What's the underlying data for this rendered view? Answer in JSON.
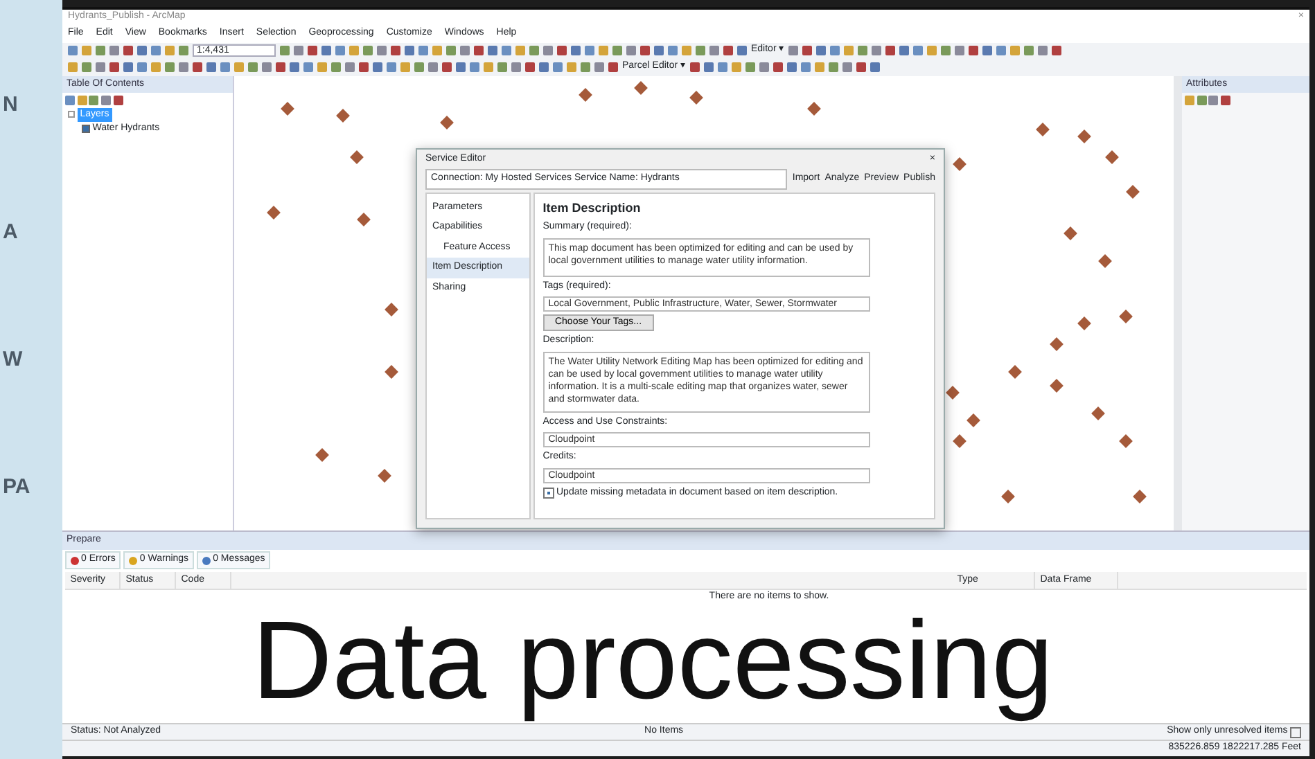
{
  "map_labels": [
    "N",
    "A",
    "W",
    "PA"
  ],
  "window": {
    "title": "Hydrants_Publish - ArcMap",
    "close": "×"
  },
  "menu": [
    "File",
    "Edit",
    "View",
    "Bookmarks",
    "Insert",
    "Selection",
    "Geoprocessing",
    "Customize",
    "Windows",
    "Help"
  ],
  "toolbar": {
    "scale": "1:4,431",
    "editor": "Editor ▾",
    "parcel_editor": "Parcel Editor ▾"
  },
  "toc": {
    "title": "Table Of Contents",
    "tree": [
      {
        "label": "Layers",
        "selected": true,
        "expanded": true,
        "children": [
          {
            "label": "Water Hydrants",
            "checked": true
          }
        ]
      }
    ]
  },
  "attributes": {
    "title": "Attributes"
  },
  "dialog": {
    "title": "Service Editor",
    "close": "×",
    "connection": "Connection: My Hosted Services   Service Name: Hydrants",
    "actions": [
      "Import",
      "Analyze",
      "Preview",
      "Publish"
    ],
    "nav": [
      {
        "label": "Parameters",
        "selected": false
      },
      {
        "label": "Capabilities",
        "selected": false,
        "children": [
          {
            "label": "Feature Access",
            "selected": false
          }
        ]
      },
      {
        "label": "Item Description",
        "selected": true
      },
      {
        "label": "Sharing",
        "selected": false
      }
    ],
    "heading": "Item Description",
    "fields": [
      {
        "kind": "textarea",
        "label": "Summary (required):",
        "value": "This map document has been optimized for editing and can be used by local government utilities to manage water utility information."
      },
      {
        "kind": "input",
        "label": "Tags (required):",
        "value": "Local Government, Public Infrastructure, Water, Sewer, Stormwater"
      },
      {
        "kind": "button",
        "label": "Choose Your Tags..."
      },
      {
        "kind": "textarea",
        "label": "Description:",
        "value": "The Water Utility Network Editing Map has been optimized for editing and can be used by local government utilities to manage water utility information.  It is a multi-scale editing map that organizes water, sewer and stormwater data."
      },
      {
        "kind": "input",
        "label": "Access and Use Constraints:",
        "value": "Cloudpoint"
      },
      {
        "kind": "input",
        "label": "Credits:",
        "value": "Cloudpoint"
      },
      {
        "kind": "checkbox",
        "label": "Update missing metadata in document based on item description.",
        "checked": true
      }
    ]
  },
  "prepare": {
    "title": "Prepare",
    "tabs": [
      {
        "label": "0 Errors",
        "kind": "error"
      },
      {
        "label": "0 Warnings",
        "kind": "warning"
      },
      {
        "label": "0 Messages",
        "kind": "message"
      }
    ],
    "columns": [
      "Severity",
      "Status",
      "Code",
      "Type",
      "Data Frame"
    ],
    "empty": "There are no items to show.",
    "status": "Status: Not Analyzed",
    "count": "No Items",
    "unresolved": {
      "label": "Show only unresolved items",
      "checked": false
    }
  },
  "status_bar": {
    "coordinates": "835226.859  1822217.285 Feet"
  },
  "overlay": "Data processing"
}
